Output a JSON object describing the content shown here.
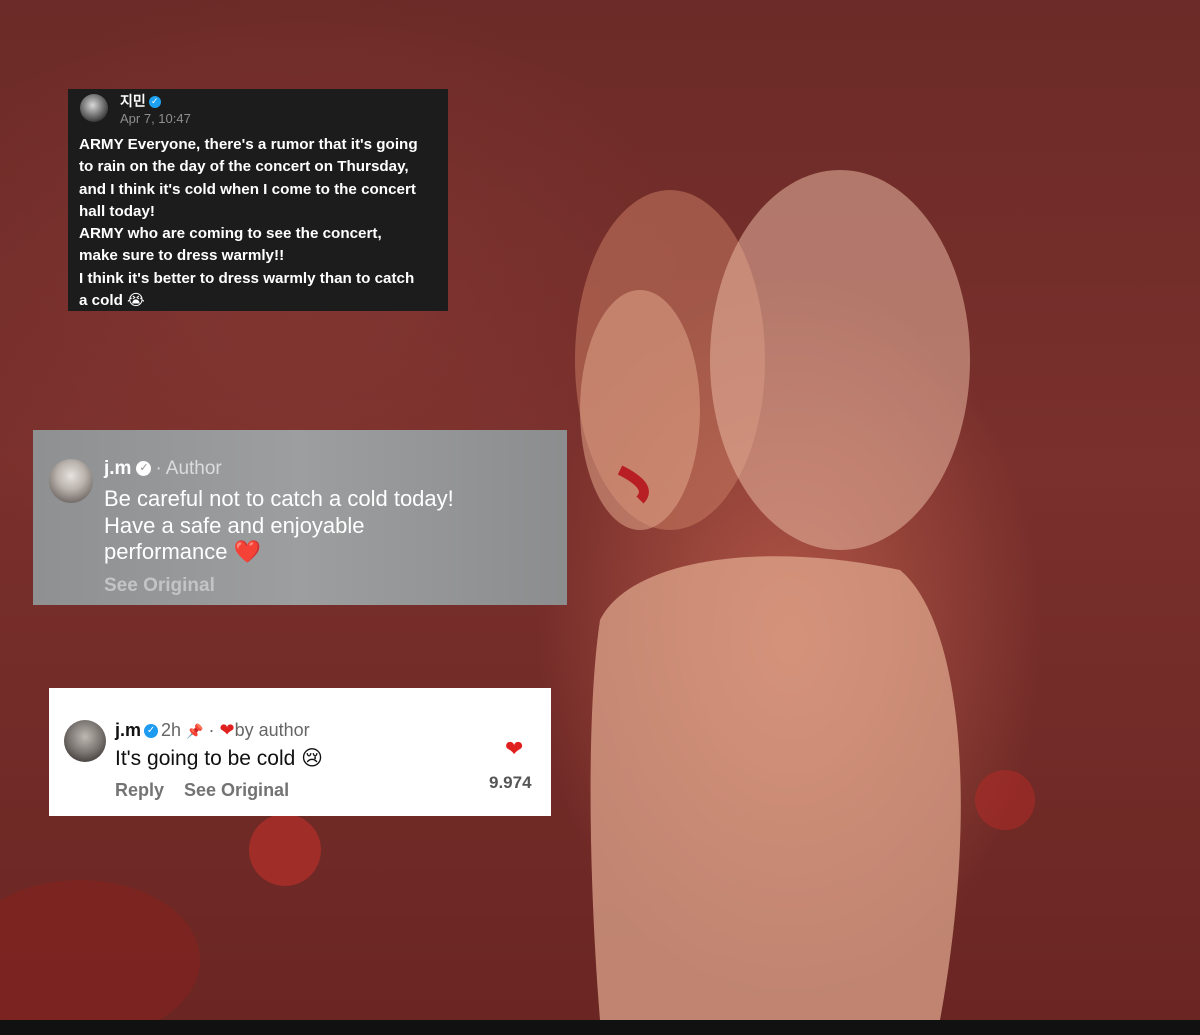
{
  "post": {
    "author": "지민",
    "date": "Apr 7, 10:47",
    "text": "ARMY Everyone, there's a rumor that it's going\nto rain on the day of the concert on Thursday,\nand I think it's cold when I come to the concert\nhall today!\nARMY who are coming to see the concert,\nmake sure to dress warmly!!\nI think it's better to dress warmly than to catch\na cold 😭"
  },
  "author_comment": {
    "username": "j.m",
    "separator": "·",
    "label": "Author",
    "text": "Be careful not to catch a cold today!\nHave a safe and enjoyable\nperformance",
    "heart": "❤️",
    "see_original": "See Original"
  },
  "reply_comment": {
    "username": "j.m",
    "time": "2h",
    "pin_icon": "📌",
    "separator": "·",
    "heart": "❤",
    "by_author": "by author",
    "text": "It's going to be cold 😢",
    "reply_label": "Reply",
    "see_original": "See Original",
    "like_heart": "❤",
    "like_count": "9.974"
  },
  "colors": {
    "background": "#6e2a26",
    "post_card": "#1c1c1c",
    "author_card": "#9d9e9f",
    "reply_card": "#ffffff",
    "heart": "#e0201f",
    "verified": "#1d9bf0"
  }
}
